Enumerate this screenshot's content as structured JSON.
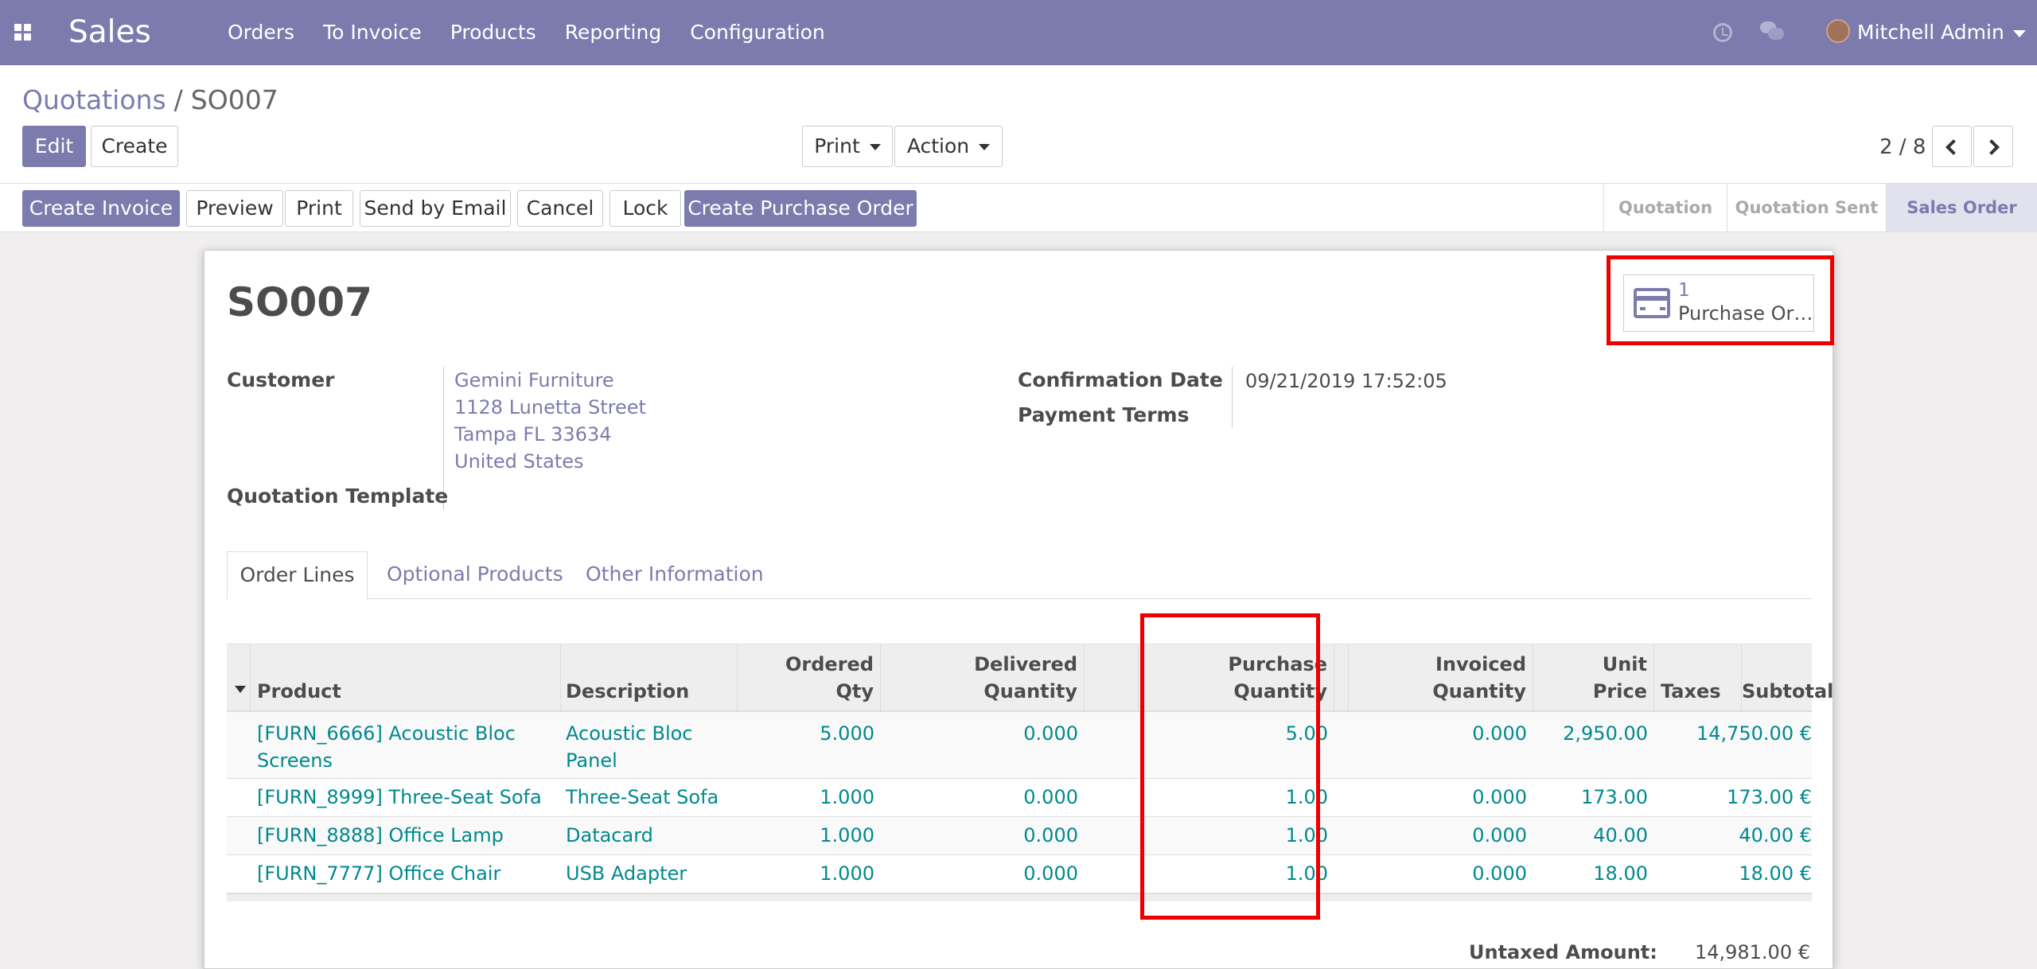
{
  "navbar": {
    "app_name": "Sales",
    "menu": [
      "Orders",
      "To Invoice",
      "Products",
      "Reporting",
      "Configuration"
    ],
    "user_name": "Mitchell Admin",
    "icons": [
      "apps-icon",
      "clock-icon",
      "chat-icon",
      "avatar",
      "caret-down-icon"
    ]
  },
  "breadcrumb": {
    "parent": "Quotations",
    "separator": "/",
    "current": "SO007"
  },
  "control": {
    "edit": "Edit",
    "create": "Create",
    "print": "Print",
    "action": "Action",
    "pager": "2 / 8"
  },
  "statusbar": {
    "buttons": [
      "Create Invoice",
      "Preview",
      "Print",
      "Send by Email",
      "Cancel",
      "Lock",
      "Create Purchase Order"
    ],
    "steps": [
      "Quotation",
      "Quotation Sent",
      "Sales Order"
    ],
    "active_step": "Sales Order"
  },
  "form": {
    "title": "SO007",
    "smart_button": {
      "count": "1",
      "label": "Purchase Or…"
    },
    "customer_label": "Customer",
    "customer_address": [
      "Gemini Furniture",
      "1128 Lunetta Street",
      "Tampa FL 33634",
      "United States"
    ],
    "quotation_template_label": "Quotation Template",
    "confirmation_date_label": "Confirmation Date",
    "confirmation_date": "09/21/2019 17:52:05",
    "payment_terms_label": "Payment Terms",
    "tabs": [
      "Order Lines",
      "Optional Products",
      "Other Information"
    ]
  },
  "order_lines": {
    "headers": {
      "product": "Product",
      "description": "Description",
      "ordered_1": "Ordered",
      "ordered_2": "Qty",
      "delivered_1": "Delivered",
      "delivered_2": "Quantity",
      "purchase_1": "Purchase",
      "purchase_2": "Quantity",
      "invoiced_1": "Invoiced",
      "invoiced_2": "Quantity",
      "unit_1": "Unit",
      "unit_2": "Price",
      "taxes": "Taxes",
      "subtotal": "Subtotal"
    },
    "rows": [
      {
        "product_1": "[FURN_6666] Acoustic Bloc",
        "product_2": "Screens",
        "description_1": "Acoustic Bloc",
        "description_2": "Panel",
        "ordered": "5.000",
        "delivered": "0.000",
        "purchase": "5.00",
        "invoiced": "0.000",
        "unit_price": "2,950.00",
        "taxes": "",
        "subtotal": "14,750.00 €"
      },
      {
        "product_1": "[FURN_8999] Three-Seat Sofa",
        "product_2": "",
        "description_1": "Three-Seat Sofa",
        "description_2": "",
        "ordered": "1.000",
        "delivered": "0.000",
        "purchase": "1.00",
        "invoiced": "0.000",
        "unit_price": "173.00",
        "taxes": "",
        "subtotal": "173.00 €"
      },
      {
        "product_1": "[FURN_8888] Office Lamp",
        "product_2": "",
        "description_1": "Datacard",
        "description_2": "",
        "ordered": "1.000",
        "delivered": "0.000",
        "purchase": "1.00",
        "invoiced": "0.000",
        "unit_price": "40.00",
        "taxes": "",
        "subtotal": "40.00 €"
      },
      {
        "product_1": "[FURN_7777] Office Chair",
        "product_2": "",
        "description_1": "USB Adapter",
        "description_2": "",
        "ordered": "1.000",
        "delivered": "0.000",
        "purchase": "1.00",
        "invoiced": "0.000",
        "unit_price": "18.00",
        "taxes": "",
        "subtotal": "18.00 €"
      }
    ]
  },
  "totals": {
    "untaxed_label": "Untaxed Amount:",
    "untaxed_value": "14,981.00 €"
  },
  "colors": {
    "brand": "#7c7bad",
    "link": "#00898e",
    "highlight": "#e00000"
  }
}
